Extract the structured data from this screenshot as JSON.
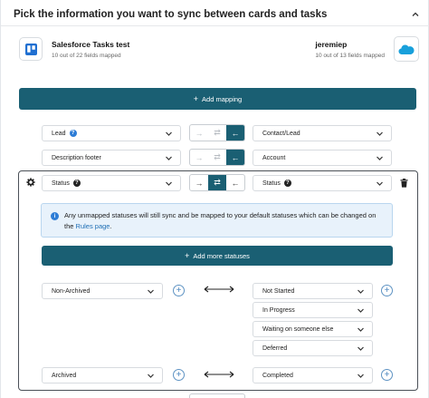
{
  "header": {
    "title": "Pick the information you want to sync between cards and tasks"
  },
  "apps": {
    "left": {
      "title": "Salesforce Tasks test",
      "subtitle": "10 out of 22 fields mapped",
      "icon": "trello-icon"
    },
    "right": {
      "title": "jeremiep",
      "subtitle": "10 out of 13 fields mapped",
      "icon": "salesforce-cloud-icon"
    }
  },
  "buttons": {
    "add_mapping": "Add mapping",
    "add_more_statuses": "Add more statuses"
  },
  "mappings": [
    {
      "left": "Lead",
      "right": "Contact/Lead",
      "direction": "right-to-left"
    },
    {
      "left": "Description footer",
      "right": "Account",
      "direction": "right-to-left"
    }
  ],
  "status_mapping": {
    "left": "Status",
    "right": "Status",
    "direction": "two-way",
    "info_text": "Any unmapped statuses will still sync and be mapped to your default statuses which can be changed on the",
    "info_link": "Rules page",
    "info_suffix": ".",
    "groups": [
      {
        "left": "Non-Archived",
        "right": [
          "Not Started",
          "In Progress",
          "Waiting on someone else",
          "Deferred"
        ]
      },
      {
        "left": "Archived",
        "right": [
          "Completed"
        ]
      }
    ]
  },
  "colors": {
    "primary": "#1a5f73",
    "link": "#1f6fb5",
    "info_bg": "#e8f2fb"
  }
}
